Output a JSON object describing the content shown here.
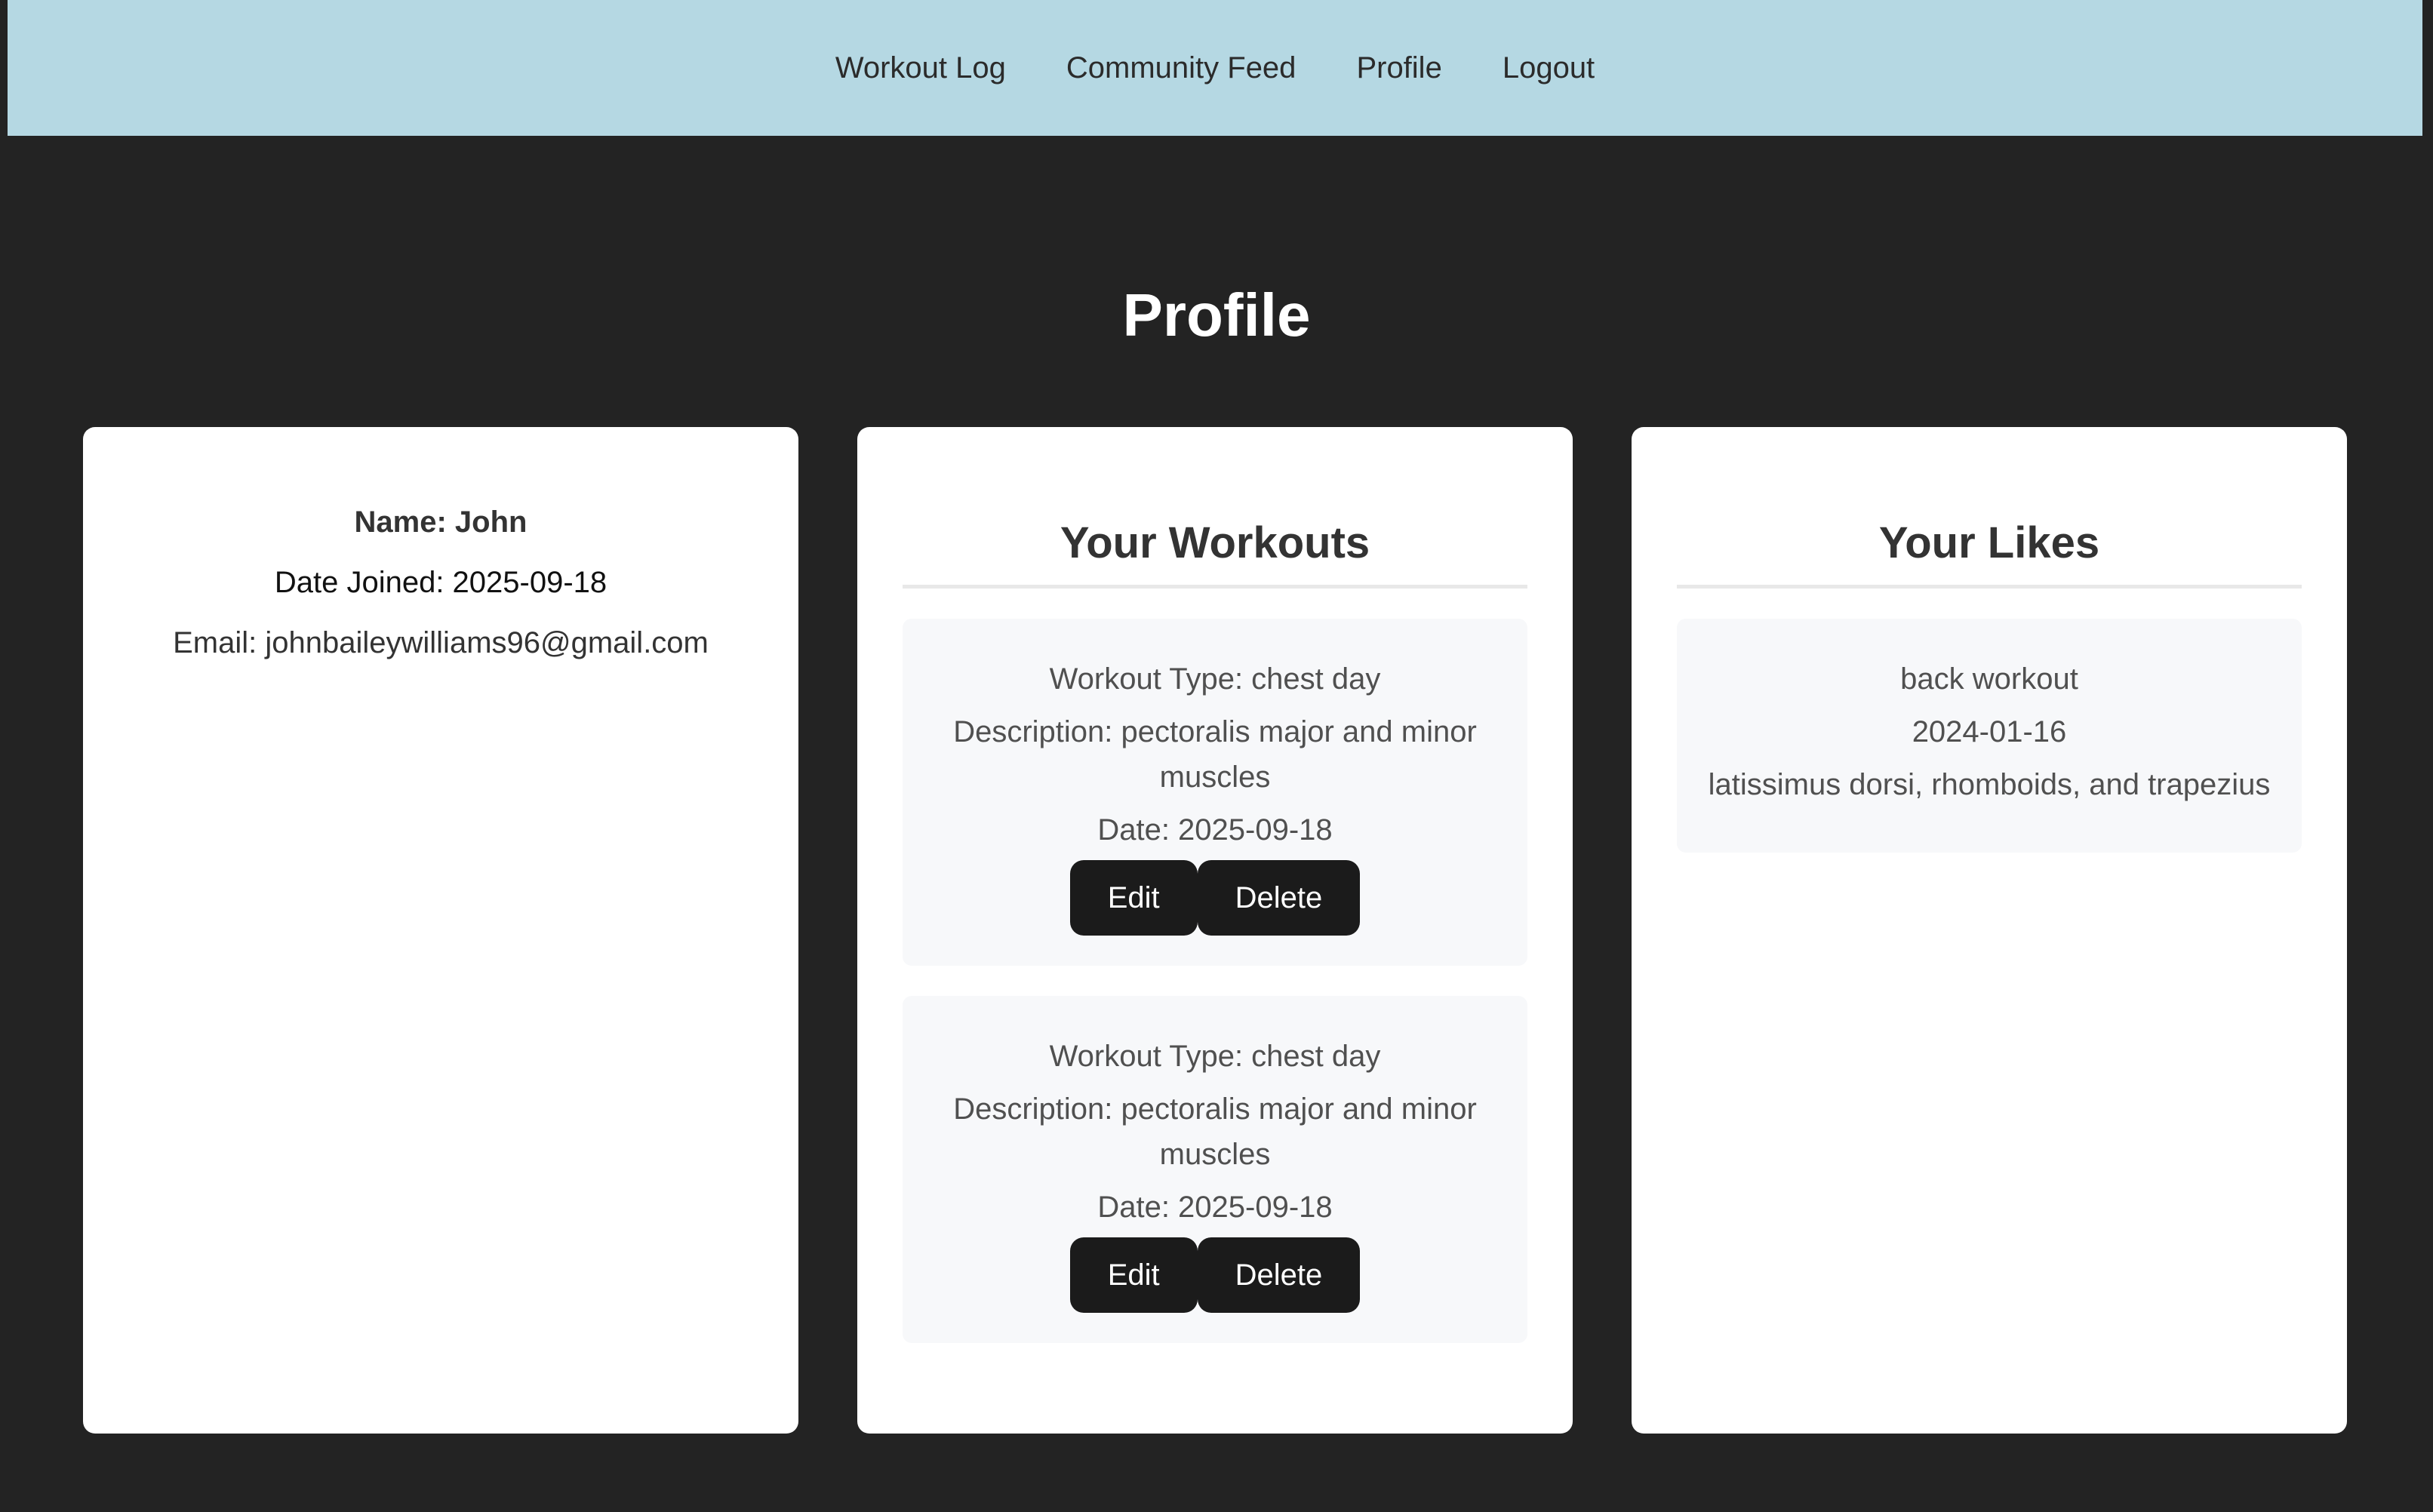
{
  "nav": {
    "items": [
      {
        "label": "Workout Log"
      },
      {
        "label": "Community Feed"
      },
      {
        "label": "Profile"
      },
      {
        "label": "Logout"
      }
    ]
  },
  "page": {
    "title": "Profile"
  },
  "profile": {
    "name": "Name: John",
    "date_joined": "Date Joined: 2025-09-18",
    "email": "Email: johnbaileywilliams96@gmail.com"
  },
  "workouts": {
    "heading": "Your Workouts",
    "items": [
      {
        "type": "Workout Type: chest day",
        "description": "Description: pectoralis major and minor muscles",
        "date": "Date: 2025-09-18",
        "edit_label": "Edit",
        "delete_label": "Delete"
      },
      {
        "type": "Workout Type: chest day",
        "description": "Description: pectoralis major and minor muscles",
        "date": "Date: 2025-09-18",
        "edit_label": "Edit",
        "delete_label": "Delete"
      }
    ]
  },
  "likes": {
    "heading": "Your Likes",
    "items": [
      {
        "title": "back workout",
        "date": "2024-01-16",
        "description": "latissimus dorsi, rhomboids, and trapezius"
      }
    ]
  },
  "colors": {
    "navbar_bg": "#b5d8e3",
    "page_bg": "#232323",
    "card_bg": "#ffffff",
    "item_bg": "#f7f8fa",
    "button_bg": "#1b1b1b"
  }
}
